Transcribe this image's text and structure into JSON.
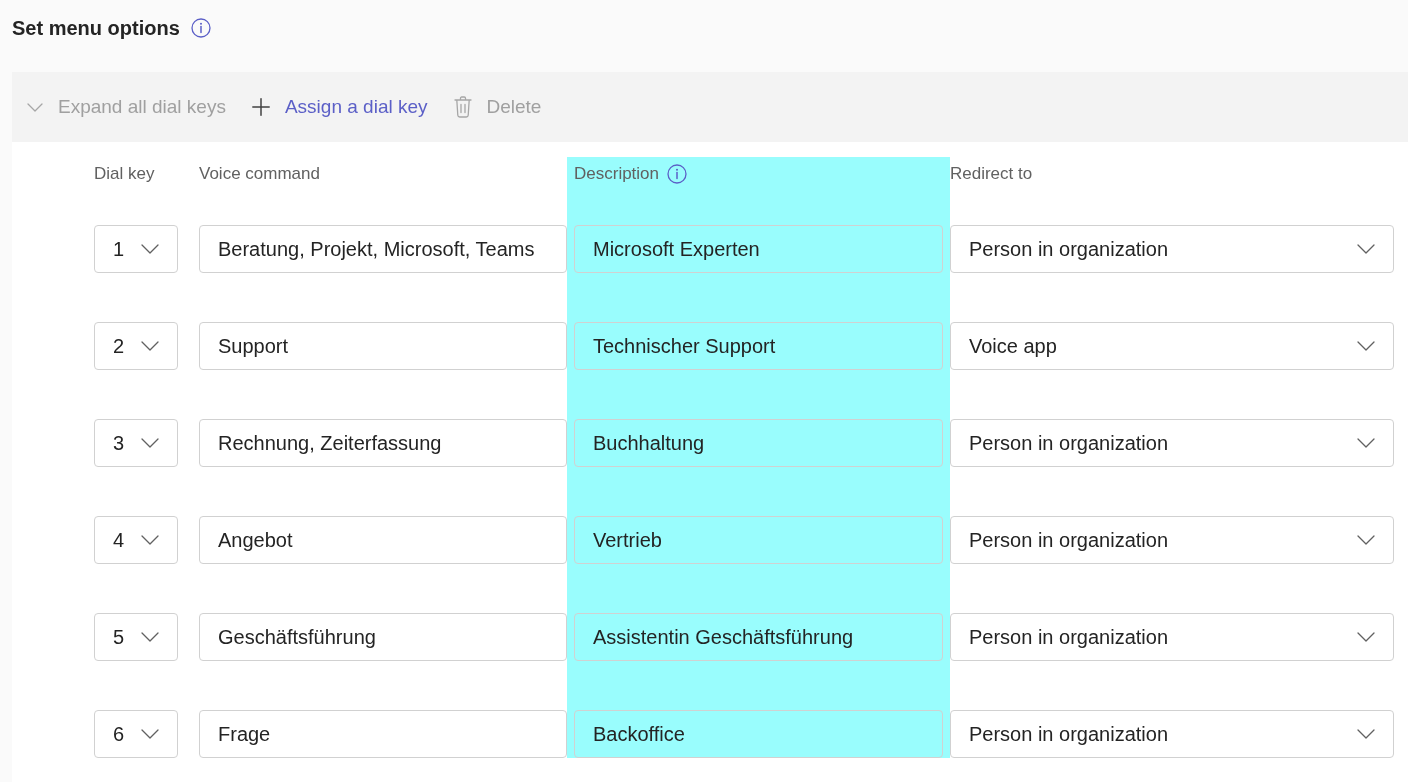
{
  "section": {
    "title": "Set menu options"
  },
  "toolbar": [
    {
      "kind": "expand",
      "label": "Expand all dial keys",
      "disabled": true
    },
    {
      "kind": "add",
      "label": "Assign a dial key",
      "disabled": false
    },
    {
      "kind": "delete",
      "label": "Delete",
      "disabled": true
    }
  ],
  "table": {
    "columns": [
      {
        "label": "Dial key",
        "info": false,
        "highlighted": false
      },
      {
        "label": "Voice command",
        "info": false,
        "highlighted": false
      },
      {
        "label": "Description",
        "info": true,
        "highlighted": true
      },
      {
        "label": "Redirect to",
        "info": false,
        "highlighted": false
      }
    ],
    "rows": [
      {
        "dial_key": "1",
        "voice_command": "Beratung, Projekt, Microsoft, Teams",
        "description": "Microsoft Experten",
        "redirect_to": "Person in organization"
      },
      {
        "dial_key": "2",
        "voice_command": "Support",
        "description": "Technischer Support",
        "redirect_to": "Voice app"
      },
      {
        "dial_key": "3",
        "voice_command": "Rechnung, Zeiterfassung",
        "description": "Buchhaltung",
        "redirect_to": "Person in organization"
      },
      {
        "dial_key": "4",
        "voice_command": "Angebot",
        "description": "Vertrieb",
        "redirect_to": "Person in organization"
      },
      {
        "dial_key": "5",
        "voice_command": "Geschäftsführung",
        "description": "Assistentin Geschäftsführung",
        "redirect_to": "Person in organization"
      },
      {
        "dial_key": "6",
        "voice_command": "Frage",
        "description": "Backoffice",
        "redirect_to": "Person in organization"
      }
    ]
  }
}
